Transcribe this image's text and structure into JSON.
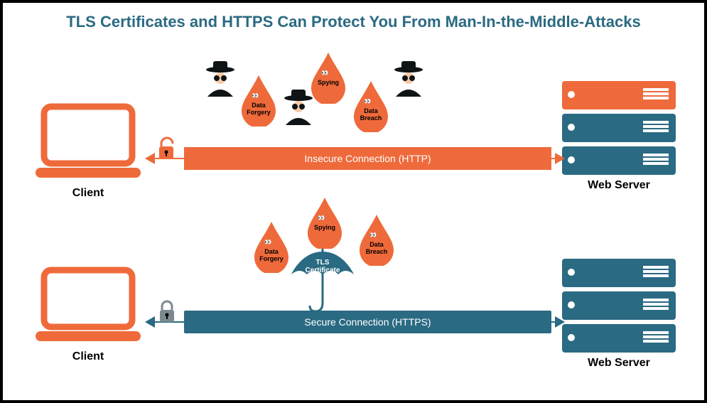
{
  "title": "TLS Certificates and HTTPS Can Protect You From Man-In-the-Middle-Attacks",
  "row1": {
    "client_label": "Client",
    "server_label": "Web Server",
    "connection_label": "Insecure Connection (HTTP)",
    "threats": {
      "forgery": "Data\nForgery",
      "spying": "Spying",
      "breach": "Data\nBreach"
    }
  },
  "row2": {
    "client_label": "Client",
    "server_label": "Web Server",
    "connection_label": "Secure Connection (HTTPS)",
    "umbrella_label": "TLS\nCertificate",
    "threats": {
      "forgery": "Data\nForgery",
      "spying": "Spying",
      "breach": "Data\nBreach"
    }
  },
  "colors": {
    "orange": "#ef6a3b",
    "teal": "#2a6a82",
    "black": "#0f1416"
  }
}
